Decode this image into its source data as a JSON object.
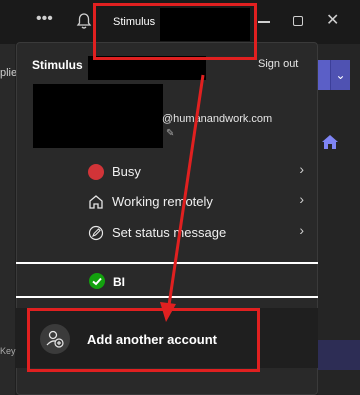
{
  "topbar": {
    "more_icon": "ellipsis-icon",
    "notifications_icon": "bell-icon",
    "account_label": "Stimulus",
    "window_controls": [
      "minimize-icon",
      "maximize-icon",
      "close-icon"
    ]
  },
  "background": {
    "left_fragment": "plie",
    "left_bottom_fragment": "Key"
  },
  "popup": {
    "account_name": "Stimulus",
    "sign_out": "Sign out",
    "email_fragment": "@humanandwork.com",
    "status_items": [
      {
        "label": "Busy",
        "icon": "busy-status-icon"
      },
      {
        "label": "Working remotely",
        "icon": "home-icon"
      },
      {
        "label": "Set status message",
        "icon": "pencil-icon"
      }
    ],
    "organization": {
      "label": "BI",
      "icon": "check-circle-icon"
    },
    "add_account": {
      "label": "Add another account",
      "icon": "add-person-icon"
    }
  },
  "colors": {
    "accent": "#5b5fc7",
    "busy": "#d13438",
    "available": "#13a10e",
    "annotation": "#e02020"
  }
}
